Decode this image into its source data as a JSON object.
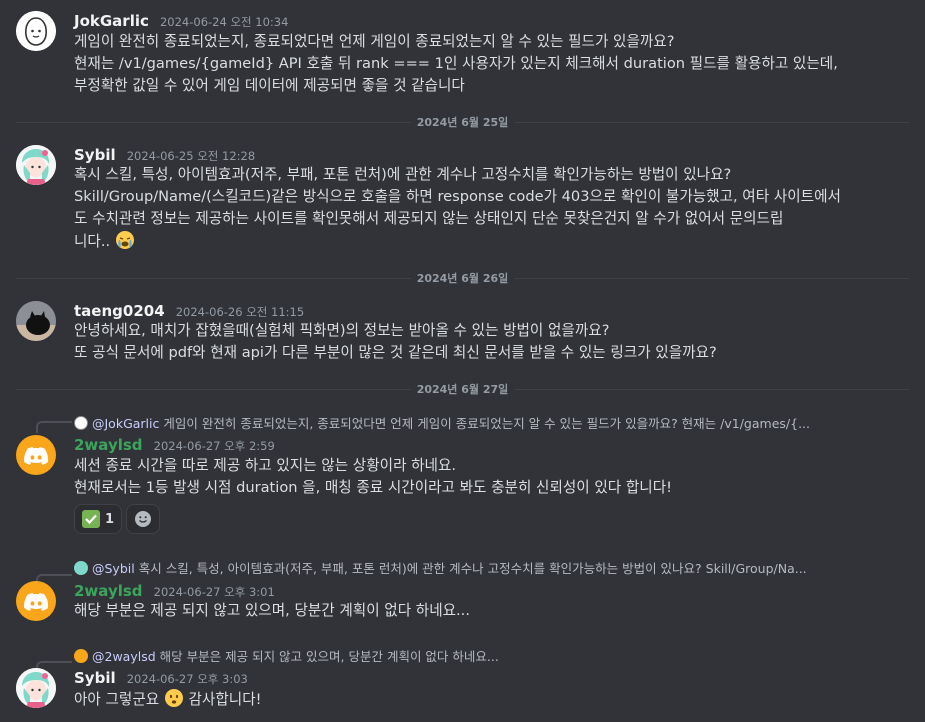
{
  "messages": [
    {
      "author": "JokGarlic",
      "timestamp": "2024-06-24 오전 10:34",
      "lines": [
        "게임이 완전히 종료되었는지, 종료되었다면 언제 게임이 종료되었는지 알 수 있는 필드가 있을까요?",
        "현재는 /v1/games/{gameId} API 호출 뒤 rank === 1인 사용자가 있는지 체크해서 duration 필드를 활용하고 있는데,",
        "부정확한 값일 수 있어 게임 데이터에 제공되면 좋을 것 같습니다"
      ]
    },
    {
      "author": "Sybil",
      "timestamp": "2024-06-25 오전 12:28",
      "lines": [
        "혹시 스킬, 특성, 아이템효과(저주, 부패, 포톤 런처)에 관한 계수나 고정수치를 확인가능하는 방법이 있나요?",
        "Skill/Group/Name/(스킬코드)같은 방식으로 호출을 하면 response code가 403으로 확인이 불가능했고, 여타 사이트에서",
        "도 수치관련 정보는 제공하는 사이트를 확인못해서 제공되지 않는 상태인지 단순 못찾은건지 알 수가 없어서 문의드립",
        "니다.."
      ]
    },
    {
      "author": "taeng0204",
      "timestamp": "2024-06-26 오전 11:15",
      "lines": [
        "안녕하세요, 매치가 잡혔을때(실험체 픽화면)의 정보는 받아올 수 있는 방법이 없을까요?",
        "또 공식 문서에 pdf와 현재 api가 다른 부분이 많은 것 같은데 최신 문서를 받을 수 있는 링크가 있을까요?"
      ]
    },
    {
      "reply_to": {
        "author": "@JokGarlic",
        "preview": "게임이 완전히 종료되었는지, 종료되었다면 언제 게임이 종료되었는지 알 수 있는 필드가 있을까요? 현재는 /v1/games/{..."
      },
      "author": "2waylsd",
      "timestamp": "2024-06-27 오후 2:59",
      "lines": [
        "세션 종료 시간을 따로 제공 하고 있지는 않는 상황이라 하네요.",
        "현재로서는 1등 발생 시점 duration 을, 매칭 종료 시간이라고 봐도 충분히 신뢰성이 있다 합니다!"
      ],
      "reaction_count": "1"
    },
    {
      "reply_to": {
        "author": "@Sybil",
        "preview": "혹시 스킬, 특성, 아이템효과(저주, 부패, 포톤 런처)에 관한 계수나 고정수치를 확인가능하는 방법이 있나요? Skill/Group/Na..."
      },
      "author": "2waylsd",
      "timestamp": "2024-06-27 오후 3:01",
      "lines": [
        "해당 부분은 제공 되지 않고 있으며, 당분간 계획이 없다 하네요..."
      ]
    },
    {
      "reply_to": {
        "author": "@2waylsd",
        "preview": "해당 부분은 제공 되지 않고 있으며, 당분간 계획이 없다 하네요..."
      },
      "author": "Sybil",
      "timestamp": "2024-06-27 오후 3:03",
      "line_before": "아아 그렇군요",
      "line_after": "감사합니다!"
    }
  ],
  "dividers": [
    "2024년 6월 25일",
    "2024년 6월 26일",
    "2024년 6월 27일"
  ],
  "colors": {
    "bot_name": "#3ba55c",
    "discord_avatar": "#faa61a",
    "background": "#313338"
  }
}
